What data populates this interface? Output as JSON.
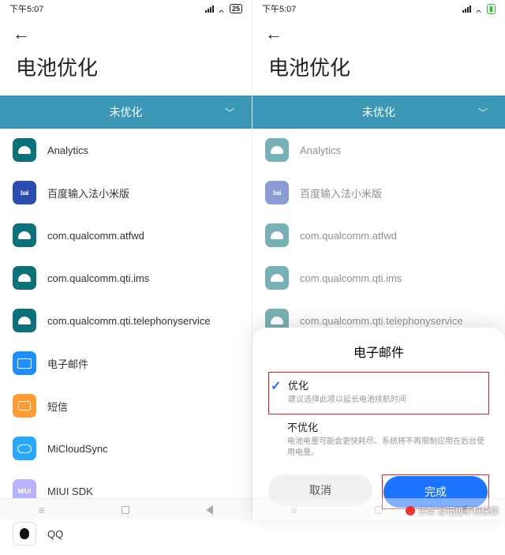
{
  "status": {
    "time": "下午5:07",
    "battery_text": "25"
  },
  "page_title": "电池优化",
  "filter": {
    "label": "未优化"
  },
  "apps_left": [
    {
      "name": "Analytics",
      "icon": "android"
    },
    {
      "name": "百度输入法小米版",
      "icon": "baidu"
    },
    {
      "name": "com.qualcomm.atfwd",
      "icon": "android"
    },
    {
      "name": "com.qualcomm.qti.ims",
      "icon": "android"
    },
    {
      "name": "com.qualcomm.qti.telephonyservice",
      "icon": "android"
    },
    {
      "name": "电子邮件",
      "icon": "mail"
    },
    {
      "name": "短信",
      "icon": "msg"
    },
    {
      "name": "MiCloudSync",
      "icon": "cloud"
    },
    {
      "name": "MIUI SDK",
      "icon": "miui"
    },
    {
      "name": "QQ",
      "icon": "qq"
    }
  ],
  "apps_right": [
    {
      "name": "Analytics",
      "icon": "android"
    },
    {
      "name": "百度输入法小米版",
      "icon": "baidu"
    },
    {
      "name": "com.qualcomm.atfwd",
      "icon": "android"
    },
    {
      "name": "com.qualcomm.qti.ims",
      "icon": "android"
    },
    {
      "name": "com.qualcomm.qti.telephonyservice",
      "icon": "android"
    }
  ],
  "dialog": {
    "title": "电子邮件",
    "opt1_title": "优化",
    "opt1_desc": "建议选择此项以延长电池续航时间",
    "opt2_title": "不优化",
    "opt2_desc": "电池电量可能会更快耗尽。系统将不再限制应用在后台使用电量。",
    "cancel": "取消",
    "done": "完成"
  },
  "watermark": "头条 @迅维手机快修",
  "baidu_icon_text": "bai",
  "miui_icon_text": "MIUI"
}
